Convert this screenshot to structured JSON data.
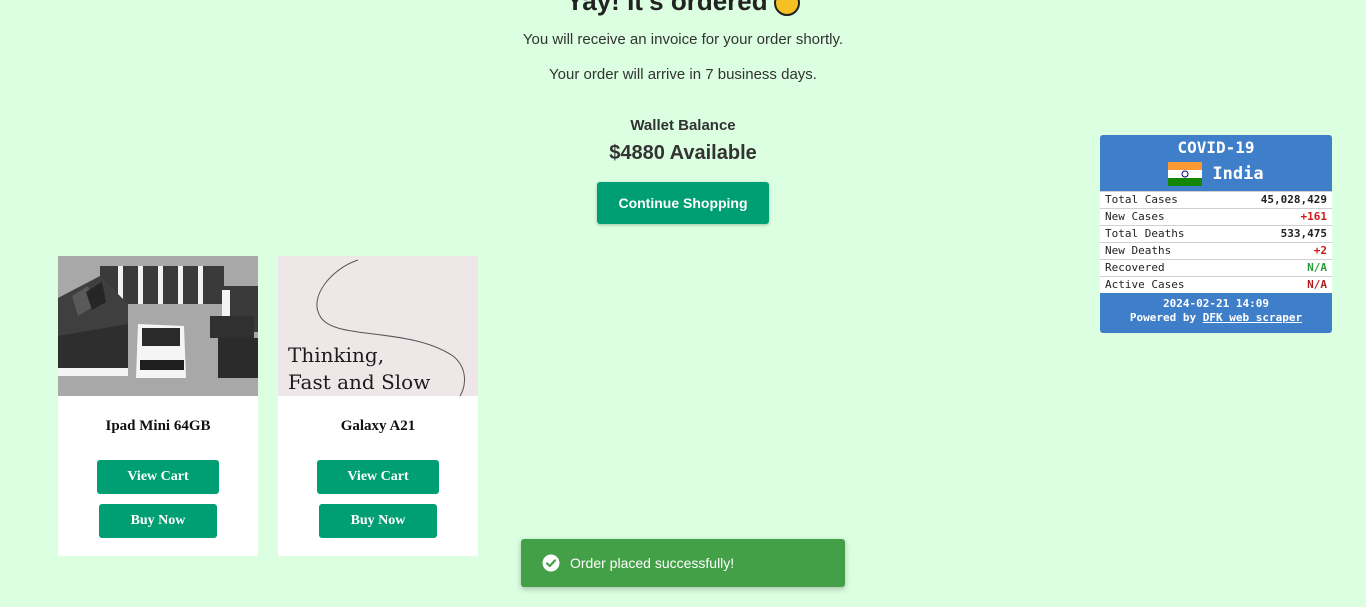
{
  "header": {
    "title": "Yay! It's ordered"
  },
  "messages": {
    "invoice": "You will receive an invoice for your order shortly.",
    "arrival": "Your order will arrive in 7 business days."
  },
  "wallet": {
    "label": "Wallet Balance",
    "amount": "$4880 Available"
  },
  "continue_label": "Continue Shopping",
  "products": [
    {
      "name": "Ipad Mini 64GB",
      "image": "sofa-set-image",
      "view_label": "View Cart",
      "buy_label": "Buy Now"
    },
    {
      "name": "Galaxy A21",
      "image": "book-cover-image",
      "image_text_line1": "Thinking,",
      "image_text_line2": "Fast and Slow",
      "view_label": "View Cart",
      "buy_label": "Buy Now"
    }
  ],
  "covid": {
    "title": "COVID-19",
    "country": "India",
    "rows": [
      {
        "label": "Total Cases",
        "value": "45,028,429"
      },
      {
        "label": "New Cases",
        "value": "+161"
      },
      {
        "label": "Total Deaths",
        "value": "533,475"
      },
      {
        "label": "New Deaths",
        "value": "+2"
      },
      {
        "label": "Recovered",
        "value": "N/A"
      },
      {
        "label": "Active Cases",
        "value": "N/A"
      }
    ],
    "timestamp": "2024-02-21 14:09",
    "powered_prefix": "Powered by",
    "powered_link": "DFK web scraper"
  },
  "toast": {
    "message": "Order placed successfully!"
  },
  "colors": {
    "background": "#dbffe0",
    "accent": "#009e73",
    "toast": "#43a047",
    "covid_panel": "#3f7ec8"
  }
}
